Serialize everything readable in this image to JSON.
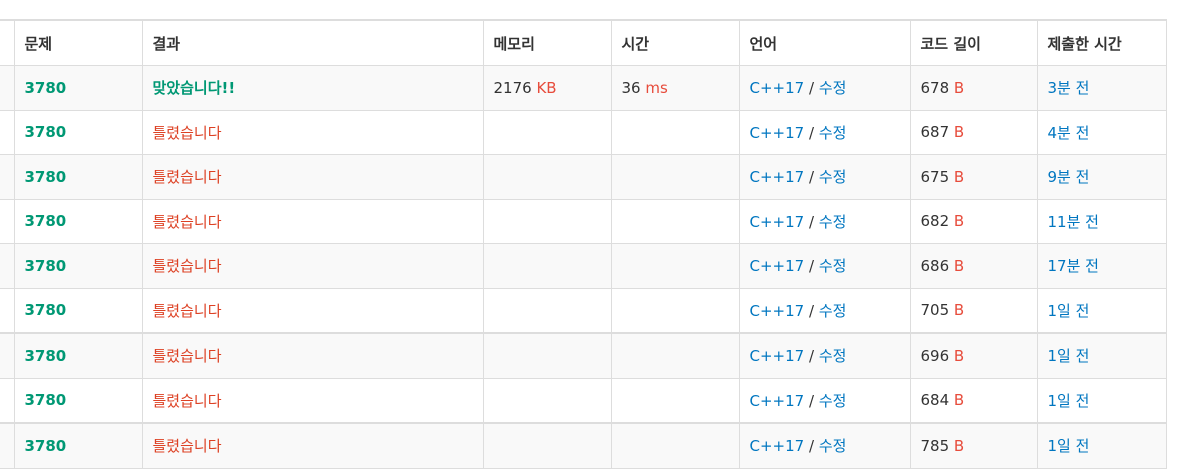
{
  "headers": [
    "문제",
    "결과",
    "메모리",
    "시간",
    "언어",
    "코드 길이",
    "제출한 시간"
  ],
  "units": {
    "memory": "KB",
    "time": "ms",
    "code": "B"
  },
  "rows": [
    {
      "problem": "3780",
      "result": "맞았습니다!!",
      "status": "accepted",
      "memory": "2176",
      "time": "36",
      "lang": "C++17",
      "edit": "수정",
      "code_length": "678",
      "submitted": "3분 전"
    },
    {
      "problem": "3780",
      "result": "틀렸습니다",
      "status": "wrong",
      "memory": "",
      "time": "",
      "lang": "C++17",
      "edit": "수정",
      "code_length": "687",
      "submitted": "4분 전"
    },
    {
      "problem": "3780",
      "result": "틀렸습니다",
      "status": "wrong",
      "memory": "",
      "time": "",
      "lang": "C++17",
      "edit": "수정",
      "code_length": "675",
      "submitted": "9분 전"
    },
    {
      "problem": "3780",
      "result": "틀렸습니다",
      "status": "wrong",
      "memory": "",
      "time": "",
      "lang": "C++17",
      "edit": "수정",
      "code_length": "682",
      "submitted": "11분 전"
    },
    {
      "problem": "3780",
      "result": "틀렸습니다",
      "status": "wrong",
      "memory": "",
      "time": "",
      "lang": "C++17",
      "edit": "수정",
      "code_length": "686",
      "submitted": "17분 전"
    },
    {
      "problem": "3780",
      "result": "틀렸습니다",
      "status": "wrong",
      "memory": "",
      "time": "",
      "lang": "C++17",
      "edit": "수정",
      "code_length": "705",
      "submitted": "1일 전"
    },
    {
      "problem": "3780",
      "result": "틀렸습니다",
      "status": "wrong",
      "memory": "",
      "time": "",
      "lang": "C++17",
      "edit": "수정",
      "code_length": "696",
      "submitted": "1일 전"
    },
    {
      "problem": "3780",
      "result": "틀렸습니다",
      "status": "wrong",
      "memory": "",
      "time": "",
      "lang": "C++17",
      "edit": "수정",
      "code_length": "684",
      "submitted": "1일 전"
    },
    {
      "problem": "3780",
      "result": "틀렸습니다",
      "status": "wrong",
      "memory": "",
      "time": "",
      "lang": "C++17",
      "edit": "수정",
      "code_length": "785",
      "submitted": "1일 전"
    }
  ],
  "colors": {
    "accepted": "#009874",
    "wrong": "#dd4124",
    "link": "#0076c0",
    "unit": "#e74c3c",
    "border": "#dddddd",
    "stripe": "#f9f9f9"
  }
}
